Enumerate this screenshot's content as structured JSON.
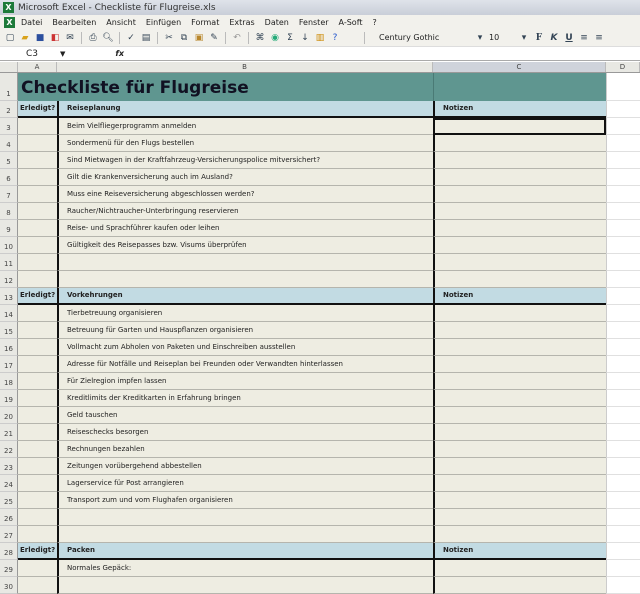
{
  "window": {
    "title": "Microsoft Excel - Checkliste für Flugreise.xls"
  },
  "menu": [
    "Datei",
    "Bearbeiten",
    "Ansicht",
    "Einfügen",
    "Format",
    "Extras",
    "Daten",
    "Fenster",
    "A-Soft",
    "?"
  ],
  "toolbar": {
    "font": "Century Gothic",
    "size": "10",
    "bold": "F",
    "italic": "K",
    "underline": "U"
  },
  "formula": {
    "cell": "C3",
    "fx": "fx",
    "value": ""
  },
  "columns": [
    "A",
    "B",
    "C",
    "D"
  ],
  "selected_cell": "C3",
  "colors": {
    "title_bg": "#5f9690",
    "header_bg": "#c2dbe3",
    "cell_bg": "#eeede2"
  },
  "rows": [
    {
      "n": "1",
      "type": "title",
      "title": "Checkliste für Flugreise"
    },
    {
      "n": "2",
      "type": "hdr",
      "a": "Erledigt?",
      "b": "Reiseplanung",
      "c": "Notizen"
    },
    {
      "n": "3",
      "b": "Beim Vielfliegerprogramm anmelden"
    },
    {
      "n": "4",
      "b": "Sondermenü für den Flugs bestellen"
    },
    {
      "n": "5",
      "b": "Sind Mietwagen in der Kraftfahrzeug-Versicherungspolice mitversichert?"
    },
    {
      "n": "6",
      "b": "Gilt die Krankenversicherung auch im Ausland?"
    },
    {
      "n": "7",
      "b": "Muss eine Reiseversicherung abgeschlossen werden?"
    },
    {
      "n": "8",
      "b": "Raucher/Nichtraucher-Unterbringung reservieren"
    },
    {
      "n": "9",
      "b": "Reise- und Sprachführer kaufen oder leihen"
    },
    {
      "n": "10",
      "b": "Gültigkeit des Reisepasses bzw. Visums überprüfen"
    },
    {
      "n": "11",
      "b": ""
    },
    {
      "n": "12",
      "b": ""
    },
    {
      "n": "13",
      "type": "hdr",
      "a": "Erledigt?",
      "b": "Vorkehrungen",
      "c": "Notizen"
    },
    {
      "n": "14",
      "b": "Tierbetreuung organisieren"
    },
    {
      "n": "15",
      "b": "Betreuung für Garten und Hauspflanzen organisieren"
    },
    {
      "n": "16",
      "b": "Vollmacht zum Abholen von Paketen und Einschreiben ausstellen"
    },
    {
      "n": "17",
      "b": "Adresse für Notfälle und Reiseplan bei Freunden oder Verwandten hinterlassen"
    },
    {
      "n": "18",
      "b": "Für Zielregion impfen lassen"
    },
    {
      "n": "19",
      "b": "Kreditlimits der Kreditkarten in Erfahrung bringen"
    },
    {
      "n": "20",
      "b": "Geld tauschen"
    },
    {
      "n": "21",
      "b": "Reiseschecks besorgen"
    },
    {
      "n": "22",
      "b": "Rechnungen bezahlen"
    },
    {
      "n": "23",
      "b": "Zeitungen vorübergehend abbestellen"
    },
    {
      "n": "24",
      "b": "Lagerservice für Post arrangieren"
    },
    {
      "n": "25",
      "b": "Transport zum und vom Flughafen organisieren"
    },
    {
      "n": "26",
      "b": ""
    },
    {
      "n": "27",
      "b": ""
    },
    {
      "n": "28",
      "type": "hdr",
      "a": "Erledigt?",
      "b": "Packen",
      "c": "Notizen"
    },
    {
      "n": "29",
      "b": "Normales Gepäck:"
    },
    {
      "n": "30",
      "b": ""
    }
  ]
}
